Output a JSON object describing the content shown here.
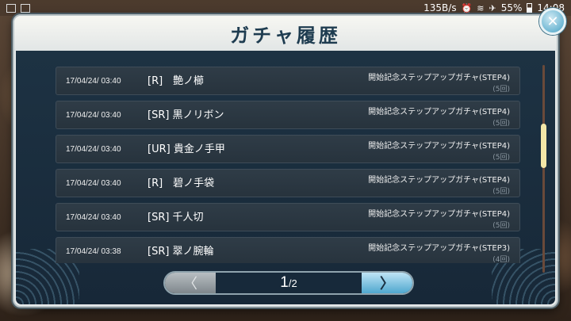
{
  "status_bar": {
    "net_speed": "135B/s",
    "battery_pct": "55%",
    "time": "14:08"
  },
  "dialog": {
    "title": "ガチャ履歴",
    "close_icon": "close-icon"
  },
  "history": [
    {
      "date": "17/04/24/ 03:40",
      "name": "[R]　艶ノ櫛",
      "gacha": "開始記念ステップアップガチャ(STEP4)",
      "count": "(5回)"
    },
    {
      "date": "17/04/24/ 03:40",
      "name": "[SR] 黒ノリボン",
      "gacha": "開始記念ステップアップガチャ(STEP4)",
      "count": "(5回)"
    },
    {
      "date": "17/04/24/ 03:40",
      "name": "[UR] 貴金ノ手甲",
      "gacha": "開始記念ステップアップガチャ(STEP4)",
      "count": "(5回)"
    },
    {
      "date": "17/04/24/ 03:40",
      "name": "[R]　碧ノ手袋",
      "gacha": "開始記念ステップアップガチャ(STEP4)",
      "count": "(5回)"
    },
    {
      "date": "17/04/24/ 03:40",
      "name": "[SR] 千人切",
      "gacha": "開始記念ステップアップガチャ(STEP4)",
      "count": "(5回)"
    },
    {
      "date": "17/04/24/ 03:38",
      "name": "[SR] 翠ノ腕輪",
      "gacha": "開始記念ステップアップガチャ(STEP3)",
      "count": "(4回)"
    }
  ],
  "pager": {
    "current": "1",
    "total": "/2",
    "prev_icon": "chevron-left-icon",
    "next_icon": "chevron-right-icon"
  },
  "scrollbar": {
    "position_fraction": 0.36
  }
}
